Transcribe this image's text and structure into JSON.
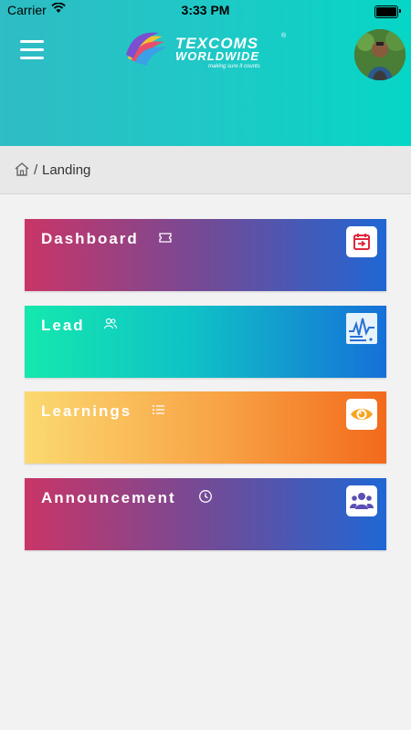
{
  "status_bar": {
    "carrier": "Carrier",
    "time": "3:33 PM"
  },
  "header": {
    "brand_line1": "TEXCOMS",
    "brand_line2": "WORLDWIDE",
    "brand_registered": "®",
    "brand_tagline": "making sure it counts"
  },
  "breadcrumb": {
    "separator": "/",
    "current": "Landing"
  },
  "cards": [
    {
      "label": "Dashboard",
      "title_icon": "ticket-icon",
      "badge_icon": "calendar-arrow-icon"
    },
    {
      "label": "Lead",
      "title_icon": "users-icon",
      "badge_icon": "chart-line-icon"
    },
    {
      "label": "Learnings",
      "title_icon": "list-icon",
      "badge_icon": "eye-icon"
    },
    {
      "label": "Announcement",
      "title_icon": "clock-icon",
      "badge_icon": "group-icon"
    }
  ],
  "colors": {
    "header_start": "#2fbcc4",
    "header_end": "#06d6c6",
    "purple_start": "#c93567",
    "purple_end": "#1f67d4",
    "teal_start": "#14e8ae",
    "orange_start": "#fbd970",
    "orange_end": "#f26a1c"
  }
}
